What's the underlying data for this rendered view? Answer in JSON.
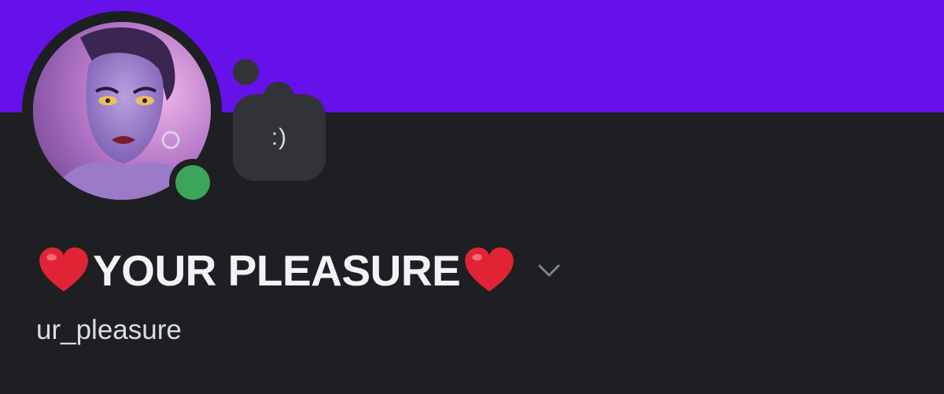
{
  "profile": {
    "custom_status": ":)",
    "display_name": "YOUR PLEASURE",
    "username": "ur_pleasure",
    "status": "online"
  },
  "icons": {
    "name_prefix": "heart-icon",
    "name_suffix": "heart-icon",
    "name_dropdown": "chevron-down-icon",
    "presence": "online-status-icon"
  },
  "colors": {
    "banner": "#6610ea",
    "background": "#1e1f22",
    "bubble": "#313338",
    "online": "#3ba55c",
    "heart": "#e02435"
  }
}
